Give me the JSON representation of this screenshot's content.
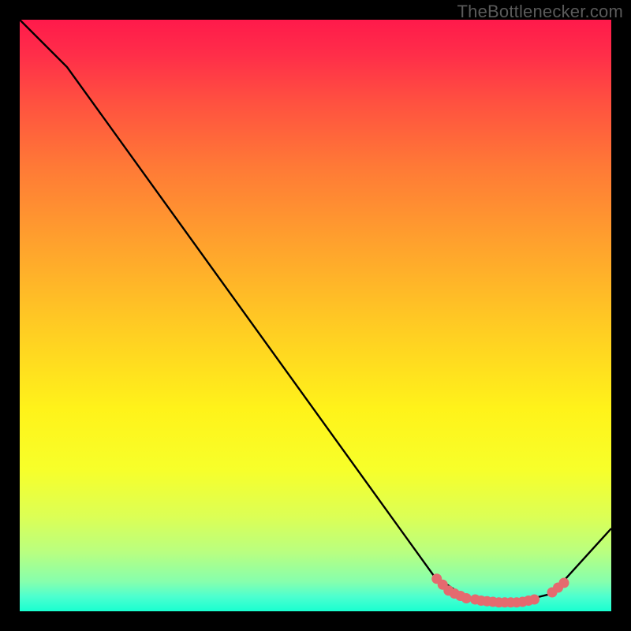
{
  "watermark": "TheBottlenecker.com",
  "chart_data": {
    "type": "line",
    "title": "",
    "xlabel": "",
    "ylabel": "",
    "xlim": [
      0,
      100
    ],
    "ylim": [
      0,
      100
    ],
    "curve": [
      {
        "x": 0,
        "y": 100
      },
      {
        "x": 8,
        "y": 92
      },
      {
        "x": 70,
        "y": 6
      },
      {
        "x": 76,
        "y": 2
      },
      {
        "x": 84,
        "y": 1.5
      },
      {
        "x": 90,
        "y": 3
      },
      {
        "x": 100,
        "y": 14
      }
    ],
    "markers": [
      {
        "x": 70.5,
        "y": 5.5
      },
      {
        "x": 71.5,
        "y": 4.5
      },
      {
        "x": 72.5,
        "y": 3.5
      },
      {
        "x": 73.5,
        "y": 3.0
      },
      {
        "x": 74.5,
        "y": 2.6
      },
      {
        "x": 75.5,
        "y": 2.2
      },
      {
        "x": 77.0,
        "y": 2.0
      },
      {
        "x": 78.0,
        "y": 1.8
      },
      {
        "x": 79.0,
        "y": 1.7
      },
      {
        "x": 80.0,
        "y": 1.6
      },
      {
        "x": 81.0,
        "y": 1.5
      },
      {
        "x": 82.0,
        "y": 1.5
      },
      {
        "x": 83.0,
        "y": 1.5
      },
      {
        "x": 84.0,
        "y": 1.5
      },
      {
        "x": 85.0,
        "y": 1.6
      },
      {
        "x": 86.0,
        "y": 1.8
      },
      {
        "x": 87.0,
        "y": 2.0
      },
      {
        "x": 90.0,
        "y": 3.2
      },
      {
        "x": 91.0,
        "y": 4.0
      },
      {
        "x": 92.0,
        "y": 4.8
      }
    ],
    "gradient_stops": [
      {
        "offset": 0.0,
        "color": "#ff1a4b"
      },
      {
        "offset": 0.06,
        "color": "#ff2e49"
      },
      {
        "offset": 0.14,
        "color": "#ff5140"
      },
      {
        "offset": 0.25,
        "color": "#ff7a36"
      },
      {
        "offset": 0.38,
        "color": "#ffa22d"
      },
      {
        "offset": 0.52,
        "color": "#ffcc23"
      },
      {
        "offset": 0.66,
        "color": "#fff31a"
      },
      {
        "offset": 0.76,
        "color": "#f7ff2a"
      },
      {
        "offset": 0.84,
        "color": "#dcff55"
      },
      {
        "offset": 0.9,
        "color": "#b9ff80"
      },
      {
        "offset": 0.95,
        "color": "#86ffad"
      },
      {
        "offset": 0.975,
        "color": "#4dffcf"
      },
      {
        "offset": 1.0,
        "color": "#19ffd0"
      }
    ],
    "marker_color": "#e46a6f",
    "curve_color": "#000000"
  }
}
